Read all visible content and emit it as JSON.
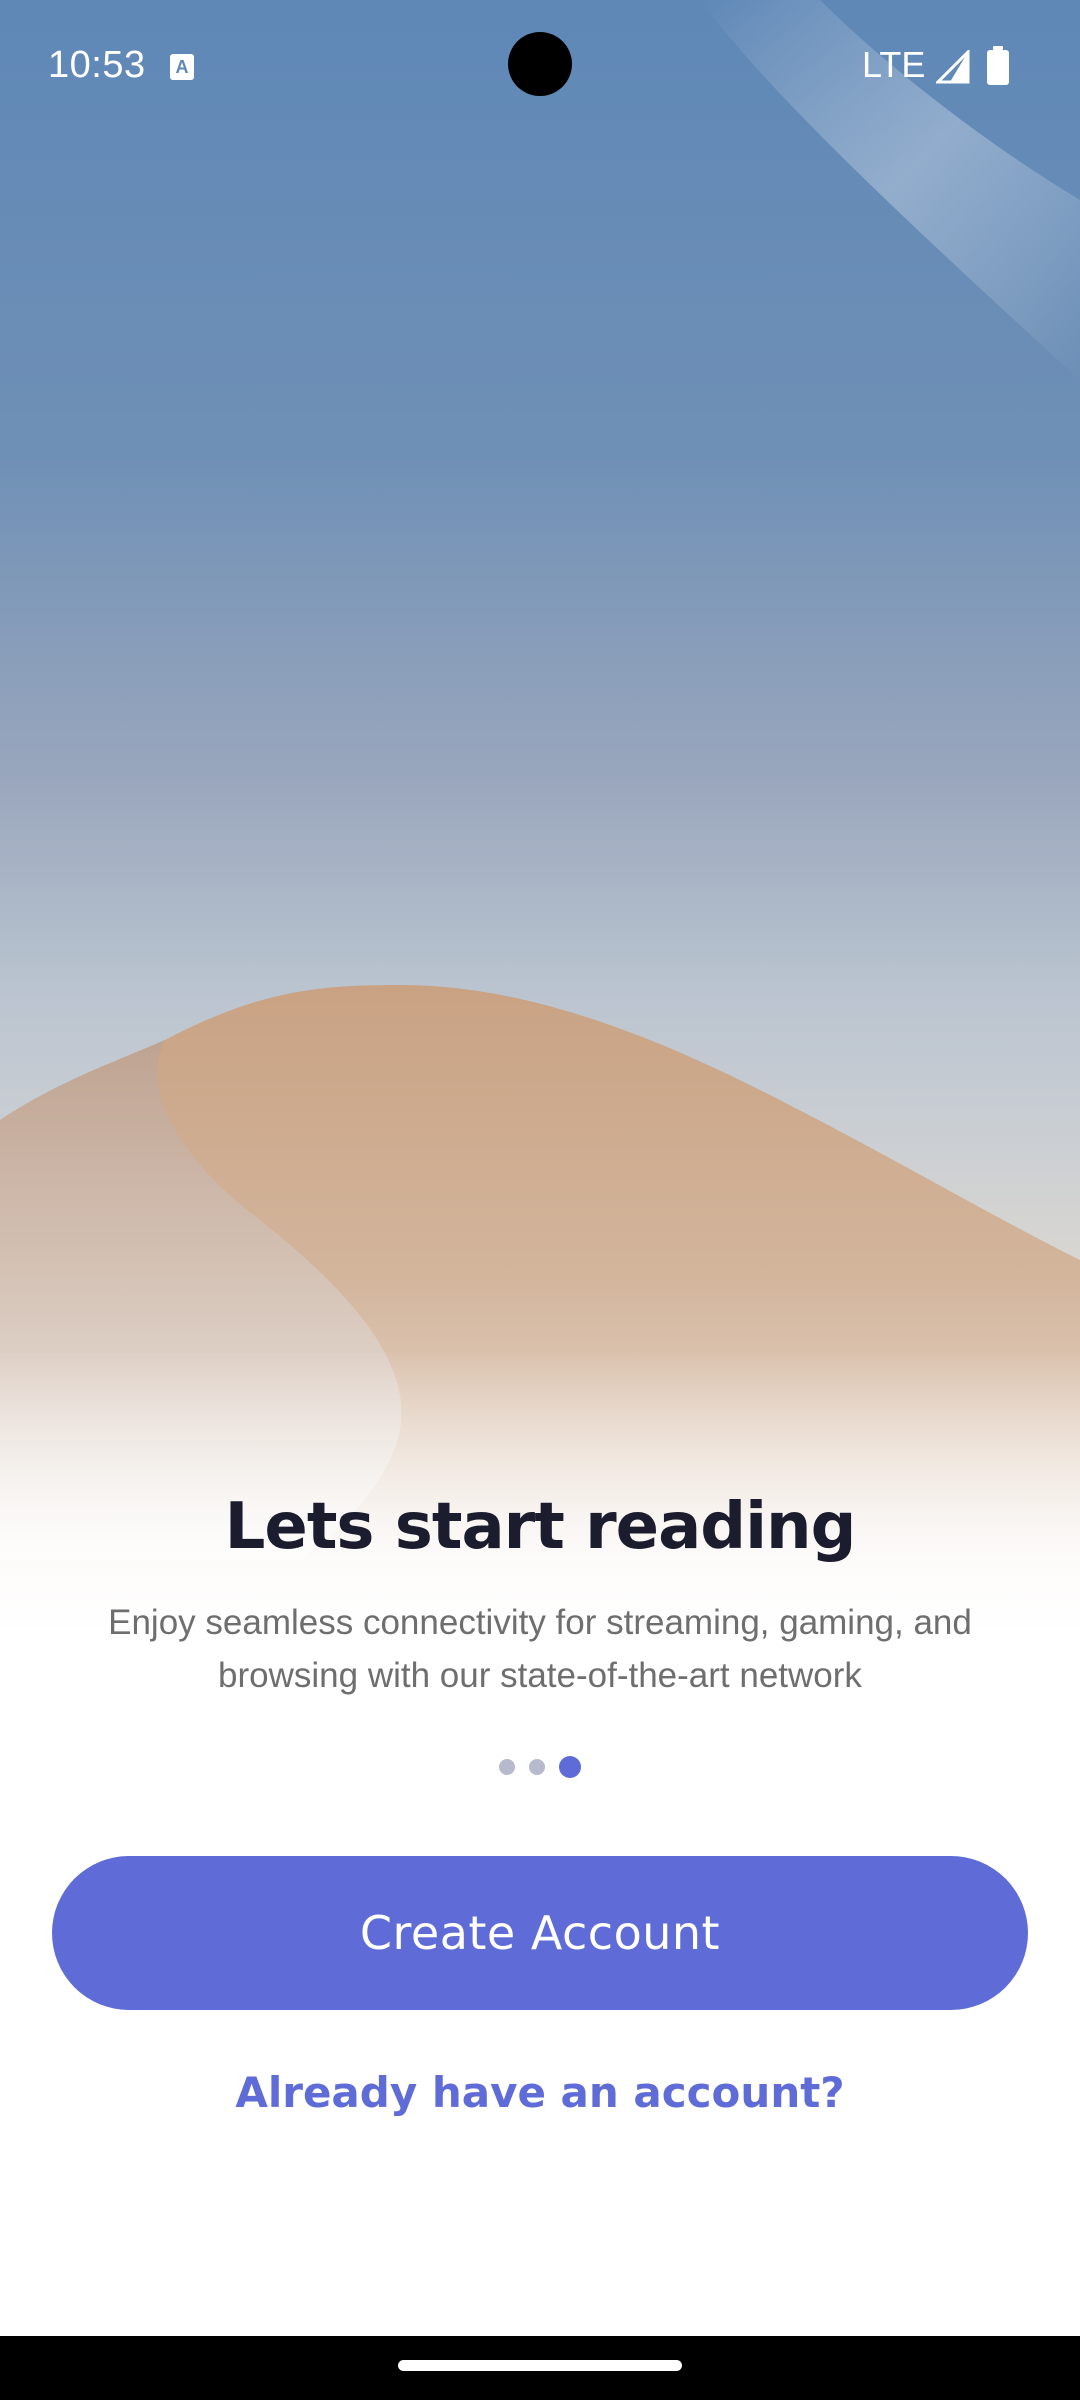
{
  "status_bar": {
    "time": "10:53",
    "network": "LTE",
    "icons": [
      "keyboard-a-icon",
      "signal-icon",
      "battery-icon"
    ]
  },
  "onboarding": {
    "title": "Lets start reading",
    "subtitle": "Enjoy seamless connectivity for streaming, gaming, and browsing with our state-of-the-art network",
    "page_indicator": {
      "total": 3,
      "current": 3
    },
    "create_account_label": "Create Account",
    "login_label": "Already have an account?"
  },
  "colors": {
    "accent": "#5f6bd7",
    "title": "#1b1c2e",
    "subtitle": "#6e6e6e",
    "dot_inactive": "#b7b9cc"
  }
}
